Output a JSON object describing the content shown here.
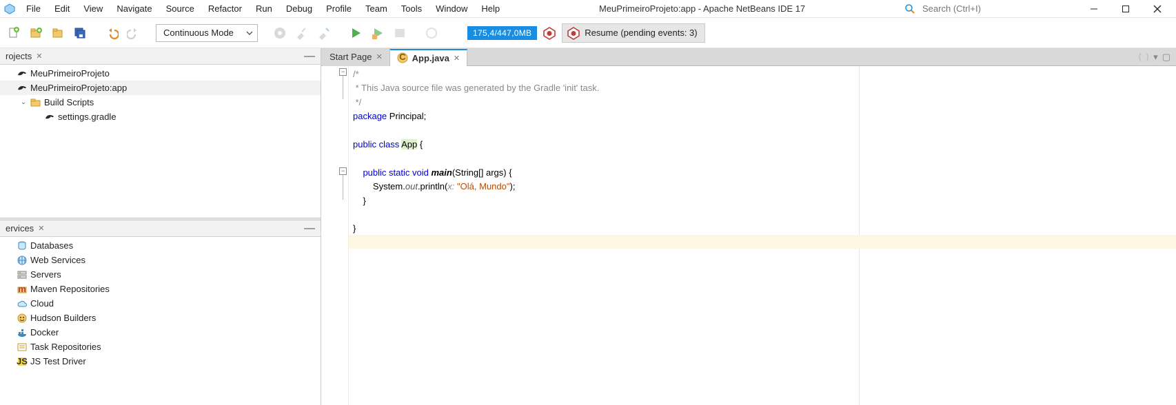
{
  "menus": [
    "File",
    "Edit",
    "View",
    "Navigate",
    "Source",
    "Refactor",
    "Run",
    "Debug",
    "Profile",
    "Team",
    "Tools",
    "Window",
    "Help"
  ],
  "app_title": "MeuPrimeiroProjeto:app - Apache NetBeans IDE 17",
  "search_placeholder": "Search (Ctrl+I)",
  "toolbar": {
    "config_dropdown": "Continuous Mode",
    "memory": "175,4/447,0MB",
    "resume_label": "Resume (pending events: 3)"
  },
  "left": {
    "projects": {
      "tab_label": "rojects",
      "items": [
        {
          "label": "MeuPrimeiroProjeto",
          "depth": 0,
          "icon": "gradle-project",
          "chev": ""
        },
        {
          "label": "MeuPrimeiroProjeto:app",
          "depth": 0,
          "icon": "gradle-project",
          "chev": "",
          "selected": true
        },
        {
          "label": "Build Scripts",
          "depth": 1,
          "icon": "folder",
          "chev": "v"
        },
        {
          "label": "settings.gradle",
          "depth": 2,
          "icon": "gradle-file",
          "chev": ""
        }
      ]
    },
    "services": {
      "tab_label": "ervices",
      "items": [
        {
          "label": "Databases",
          "icon": "database"
        },
        {
          "label": "Web Services",
          "icon": "globe"
        },
        {
          "label": "Servers",
          "icon": "server"
        },
        {
          "label": "Maven Repositories",
          "icon": "maven"
        },
        {
          "label": "Cloud",
          "icon": "cloud"
        },
        {
          "label": "Hudson Builders",
          "icon": "hudson"
        },
        {
          "label": "Docker",
          "icon": "docker"
        },
        {
          "label": "Task Repositories",
          "icon": "tasks"
        },
        {
          "label": "JS Test Driver",
          "icon": "js"
        }
      ]
    }
  },
  "editor": {
    "tabs": [
      {
        "label": "Start Page",
        "active": false
      },
      {
        "label": "App.java",
        "active": true,
        "icon": "java-class"
      }
    ],
    "code": {
      "l1": "/*",
      "l2": " * This Java source file was generated by the Gradle 'init' task.",
      "l3": " */",
      "l4a": "package",
      "l4b": " Principal;",
      "l5": "",
      "l6a": "public",
      "l6b": " ",
      "l6c": "class",
      "l6d": " ",
      "l6e": "App",
      "l6f": " {",
      "l7": "",
      "l8a": "    ",
      "l8b": "public",
      "l8c": " ",
      "l8d": "static",
      "l8e": " ",
      "l8f": "void",
      "l8g": " ",
      "l8h": "main",
      "l8i": "(String[] args) {",
      "l9a": "        System.",
      "l9b": "out",
      "l9c": ".println(",
      "l9d": "x:",
      "l9e": " ",
      "l9f": "\"Olá, Mundo\"",
      "l9g": ");",
      "l10": "    }",
      "l11": "",
      "l12": "}"
    }
  }
}
